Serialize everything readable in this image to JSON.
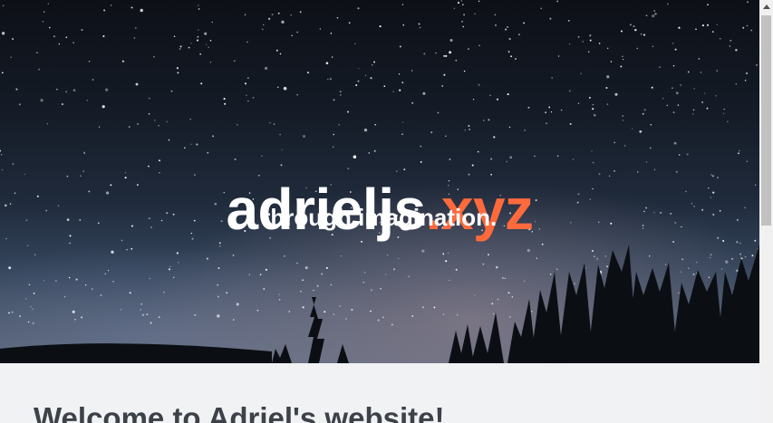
{
  "hero": {
    "site_name": "adrieljs",
    "site_tld": ".xyz",
    "tagline": "through imagination."
  },
  "content": {
    "heading": "Welcome to Adriel's website!"
  },
  "colors": {
    "accent": "#ff6a3d",
    "hero_text": "#ffffff",
    "heading_text": "#3d4148",
    "page_background": "#f1f2f4"
  }
}
